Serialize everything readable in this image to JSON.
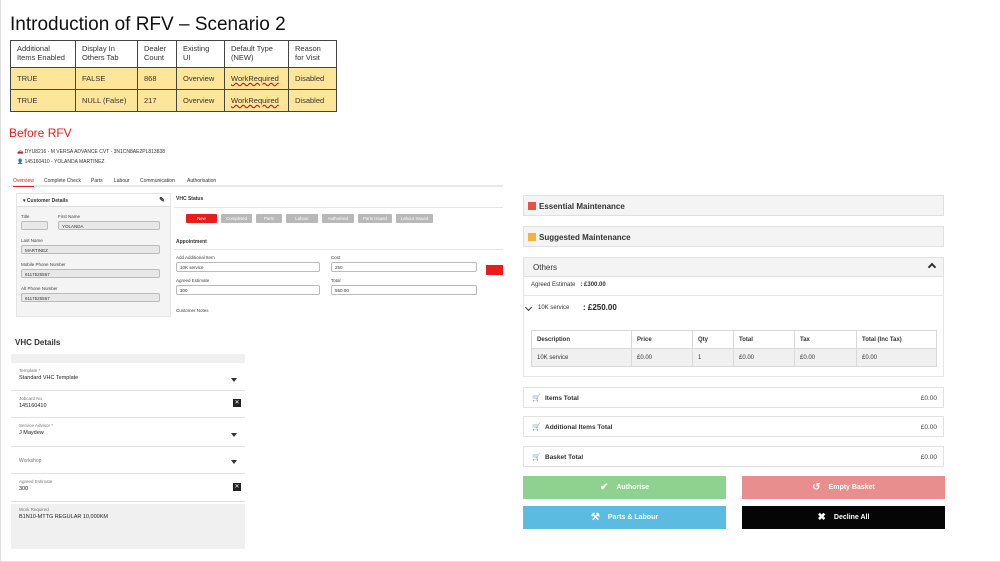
{
  "slide": {
    "title": "Introduction of RFV – Scenario 2",
    "before_label": "Before RFV"
  },
  "summary_table": {
    "headers": [
      "Additional Items Enabled",
      "Display In Others Tab",
      "Dealer Count",
      "Existing UI",
      "Default Type (NEW)",
      "Reason for Visit"
    ],
    "rows": [
      [
        "TRUE",
        "FALSE",
        "868",
        "Overview",
        "WorkRequired",
        "Disabled"
      ],
      [
        "TRUE",
        "NULL (False)",
        "217",
        "Overview",
        "WorkRequired",
        "Disabled"
      ]
    ]
  },
  "before": {
    "vehicle_line": "DYU8216 - M VERSA ADVANCE CVT - 3N1CN8AE2PL813838",
    "customer_line": "145160410 - YOLANDA MARTINEZ",
    "tabs": [
      "Overview",
      "Complete Check",
      "Parts",
      "Labour",
      "Communication",
      "Authorisation"
    ],
    "customer_details": {
      "title": "Customer Details",
      "title_label": "Title",
      "first_name_label": "First Name",
      "first_name": "YOLANDA",
      "last_name_label": "Last Name",
      "last_name": "MARTINEZ",
      "mobile_label": "Mobile Phone Number",
      "mobile": "6117525867",
      "alt_label": "Alt Phone Number",
      "alt": "6117525867"
    },
    "vhc_status": {
      "title": "VHC Status",
      "chips": [
        "New",
        "Completed",
        "Parts",
        "Labour",
        "Authorised",
        "Parts Issued",
        "Labour Issued"
      ]
    },
    "appointment": {
      "title": "Appointment",
      "add_item_label": "Add Additional Item",
      "add_item_value": "10K service",
      "cost_label": "Cost",
      "cost_value": "250",
      "agreed_label": "Agreed Estimate",
      "agreed_value": "300",
      "total_label": "Total",
      "total_value": "550.00",
      "notes_label": "Customer Notes"
    }
  },
  "vhc_details": {
    "title": "VHC Details",
    "template_label": "Template *",
    "template_value": "Standard VHC Template",
    "jobcard_label": "Jobcard No",
    "jobcard_value": "145160410",
    "advisor_label": "Service Advisor *",
    "advisor_value": "J Maydew",
    "workshop_label": "Workshop",
    "estimate_label": "Agreed Estimate",
    "estimate_value": "300",
    "work_label": "Work Required",
    "work_value": "B1N10-MTTG REGULAR 10,000KM"
  },
  "basket": {
    "essential": "Essential Maintenance",
    "suggested": "Suggested Maintenance",
    "others": "Others",
    "agreed_label": "Agreed Estimate",
    "agreed_value": ": £300.00",
    "service_name": "10K service",
    "service_price": ": £250.00",
    "columns": [
      "Description",
      "Price",
      "Qty",
      "Total",
      "Tax",
      "Total (Inc Tax)"
    ],
    "row": [
      "10K service",
      "£0.00",
      "1",
      "£0.00",
      "£0.00",
      "£0.00"
    ],
    "items_total_label": "Items Total",
    "items_total": "£0.00",
    "additional_total_label": "Additional Items Total",
    "additional_total": "£0.00",
    "basket_total_label": "Basket Total",
    "basket_total": "£0.00",
    "authorise": "Authorise",
    "empty": "Empty Basket",
    "parts_labour": "Parts & Labour",
    "decline": "Decline All"
  },
  "colors": {
    "essential": "#e05545",
    "suggested": "#f4b243",
    "authorise": "#8fd18f",
    "empty": "#e88e8e",
    "parts": "#5bbbe0",
    "decline": "#050505",
    "accent_red": "#e02020"
  }
}
